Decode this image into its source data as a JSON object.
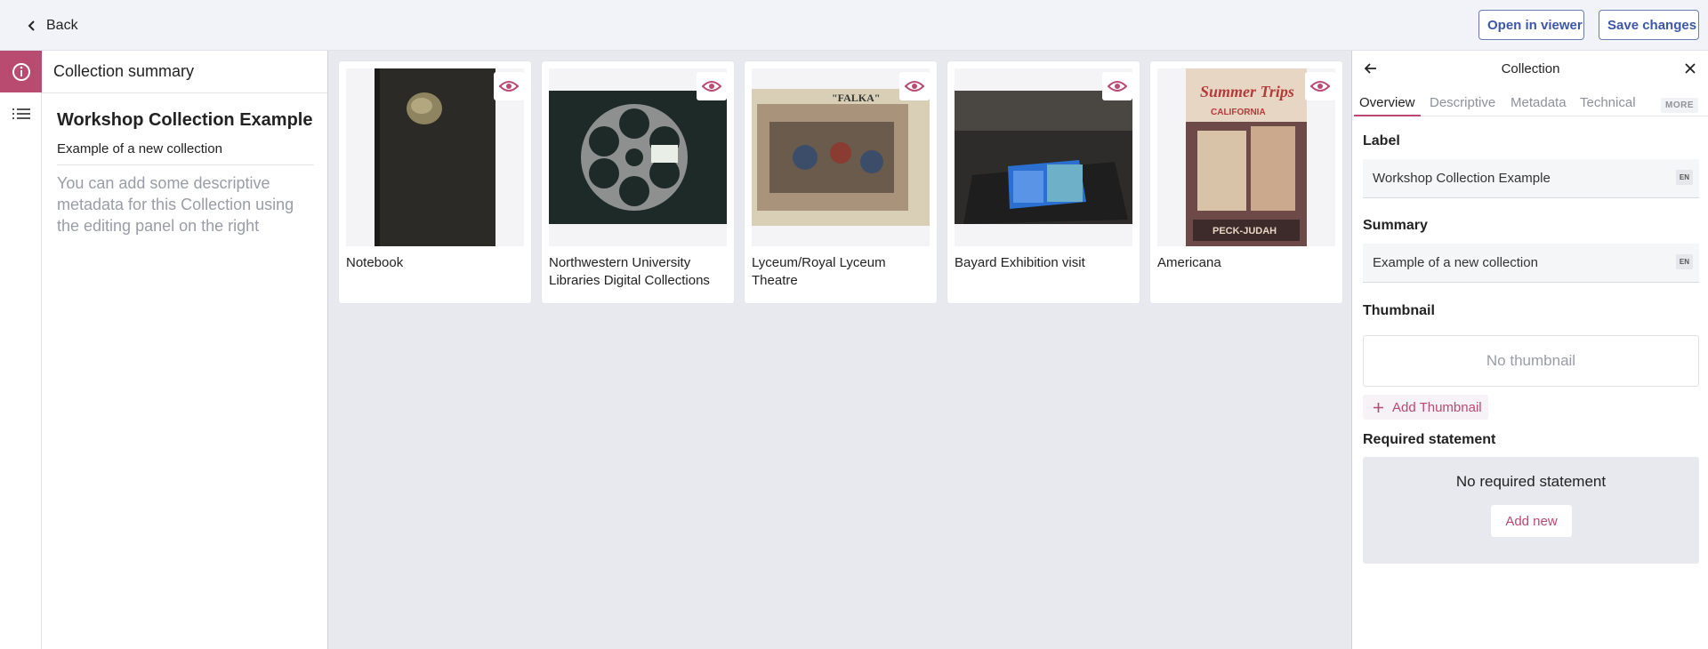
{
  "topbar": {
    "back_label": "Back",
    "open_viewer_label": "Open in viewer",
    "save_label": "Save changes"
  },
  "summary": {
    "header": "Collection summary",
    "title": "Workshop Collection Example",
    "subtitle": "Example of a new collection",
    "hint": "You can add some descriptive metadata for this Collection using the editing panel on the right"
  },
  "cards": [
    {
      "label": "Notebook"
    },
    {
      "label": "Northwestern University Libraries Digital Collections"
    },
    {
      "label": "Lyceum/Royal Lyceum Theatre"
    },
    {
      "label": "Bayard Exhibition visit"
    },
    {
      "label": "Americana"
    }
  ],
  "poster_text": {
    "falka": "\"FALKA\"",
    "summer": "Summer Trips",
    "california": "CALIFORNIA",
    "peck": "PECK-JUDAH"
  },
  "right_panel": {
    "title": "Collection",
    "tabs": [
      "Overview",
      "Descriptive",
      "Metadata",
      "Technical"
    ],
    "more_label": "MORE",
    "label_heading": "Label",
    "label_value": "Workshop Collection Example",
    "label_lang": "EN",
    "summary_heading": "Summary",
    "summary_value": "Example of a new collection",
    "summary_lang": "EN",
    "thumbnail_heading": "Thumbnail",
    "no_thumbnail": "No thumbnail",
    "add_thumbnail": "Add Thumbnail",
    "required_heading": "Required statement",
    "no_required": "No required statement",
    "add_new": "Add new"
  },
  "colors": {
    "accent": "#b84b6f",
    "button_text": "#3d57a8"
  }
}
